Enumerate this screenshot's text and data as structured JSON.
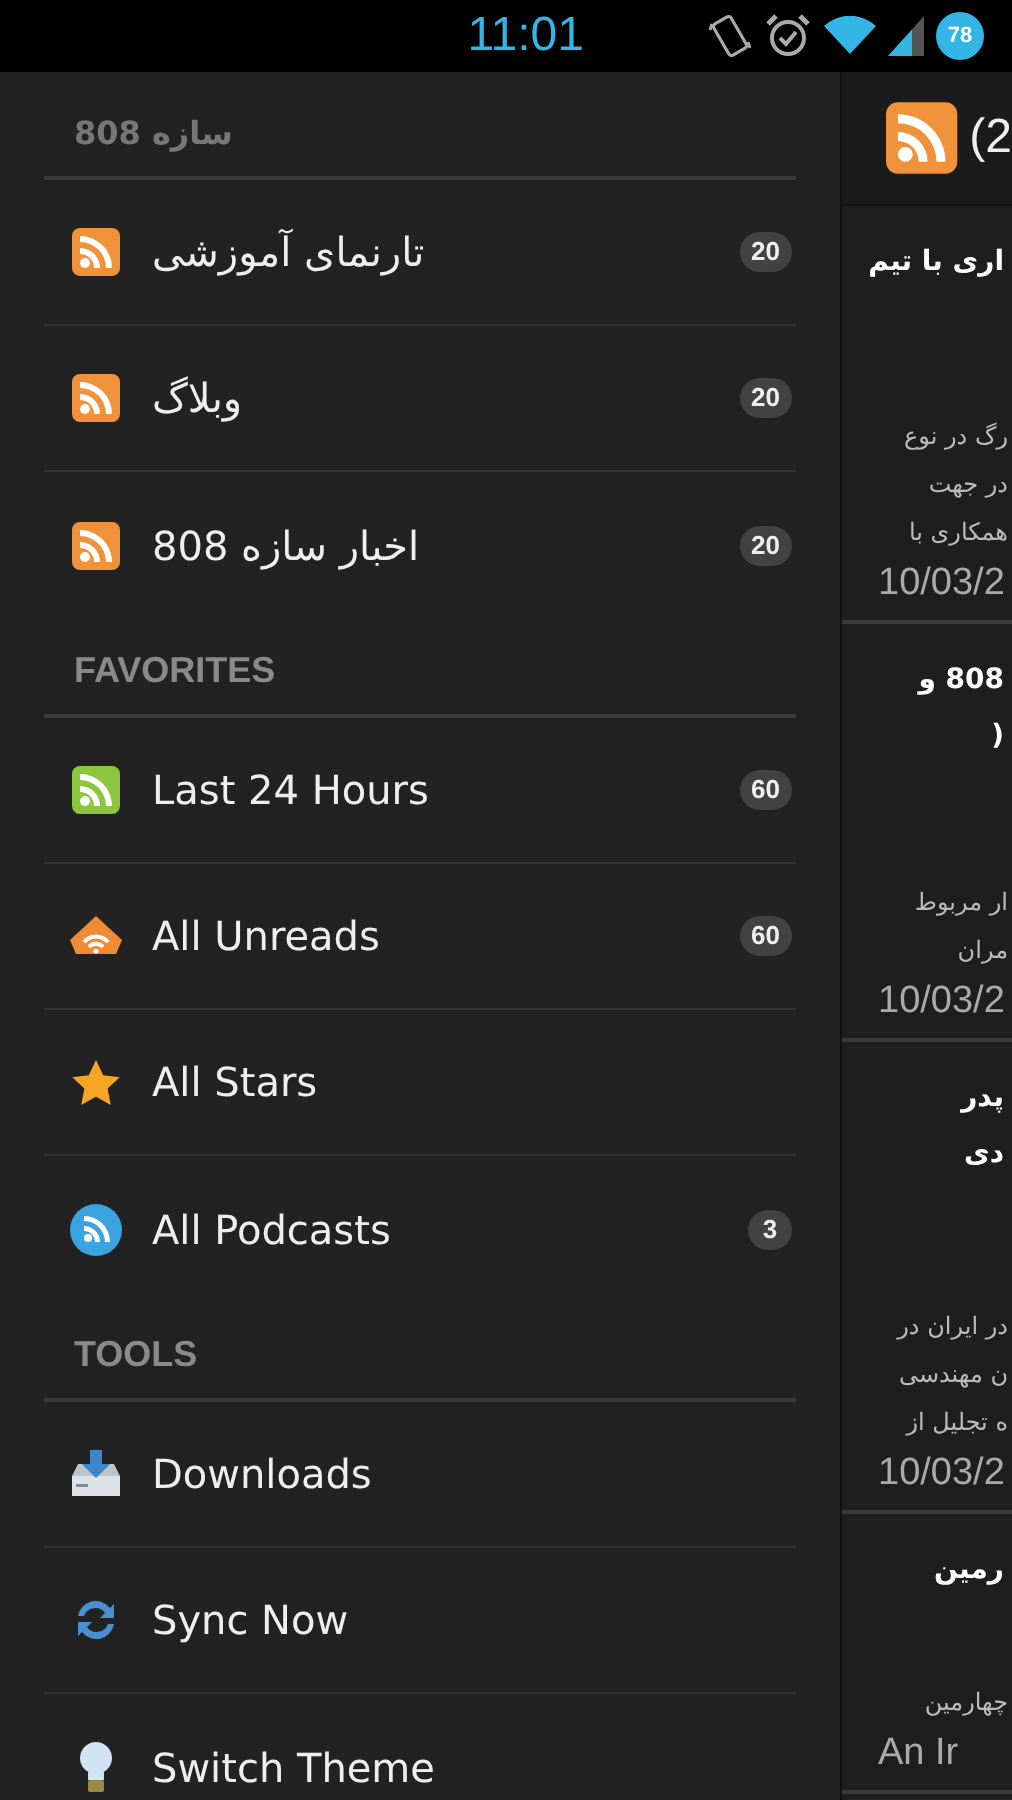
{
  "status_bar": {
    "time": "11:01",
    "battery": "78"
  },
  "drawer": {
    "sections": [
      {
        "title": "سازه 808",
        "kind": "feeds",
        "items": [
          {
            "label": "تارنمای آموزشی",
            "kind": "rss",
            "count": "20"
          },
          {
            "label": "وبلاگ",
            "kind": "rss",
            "count": "20"
          },
          {
            "label": "اخبار سازه 808",
            "kind": "rss",
            "count": "20"
          }
        ]
      },
      {
        "title": "FAVORITES",
        "kind": "group",
        "items": [
          {
            "label": "Last 24 Hours",
            "kind": "recent",
            "count": "60"
          },
          {
            "label": "All Unreads",
            "kind": "unreads",
            "count": "60"
          },
          {
            "label": "All Stars",
            "kind": "star"
          },
          {
            "label": "All Podcasts",
            "kind": "podcast",
            "count": "3"
          }
        ]
      },
      {
        "title": "TOOLS",
        "kind": "group",
        "items": [
          {
            "label": "Downloads",
            "kind": "download"
          },
          {
            "label": "Sync Now",
            "kind": "sync"
          },
          {
            "label": "Switch Theme",
            "kind": "bulb"
          }
        ]
      }
    ]
  },
  "article_panel": {
    "header_title": "(2",
    "articles": [
      {
        "title_lines": [
          "اری با تیم"
        ],
        "snippet_lines": [
          "رگ در نوع",
          "در جهت",
          "همکاری با"
        ],
        "date": "10/03/2"
      },
      {
        "title_lines": [
          "808 و",
          "("
        ],
        "snippet_lines": [
          "ار مربوط",
          "مران"
        ],
        "date": "10/03/2"
      },
      {
        "title_lines": [
          "پدر",
          "دی"
        ],
        "snippet_lines": [
          "در ایران در",
          "ن مهندسی",
          "ه تجلیل از"
        ],
        "date": "10/03/2"
      },
      {
        "title_lines": [
          "رمین"
        ],
        "snippet_lines": [
          "چهارمین"
        ],
        "date": "An Ir"
      }
    ]
  }
}
